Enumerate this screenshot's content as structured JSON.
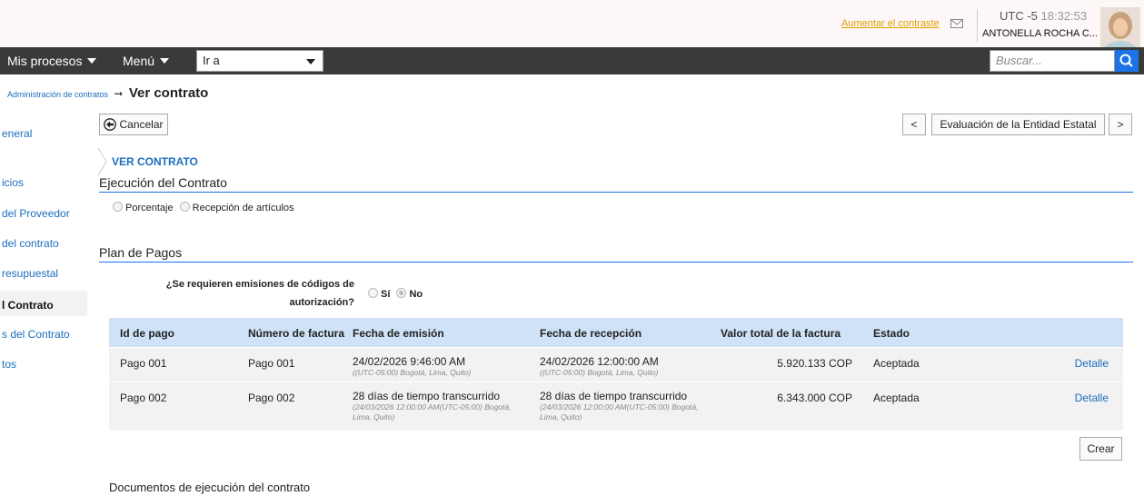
{
  "header": {
    "contrast_link": "Aumentar el contraste",
    "timezone_label": "UTC -5",
    "clock": "18:32:53",
    "username": "ANTONELLA ROCHA C..."
  },
  "nav": {
    "my_processes": "Mis procesos",
    "menu": "Menú",
    "goto_value": "Ir a",
    "search_placeholder": "Buscar..."
  },
  "breadcrumb": {
    "parent": "Administración de contratos",
    "arrow": "➞",
    "current": "Ver contrato"
  },
  "sidebar": {
    "items": [
      "eneral",
      "icios",
      "del Proveedor",
      "del contrato",
      "resupuestal",
      "l Contrato",
      "s del Contrato",
      "tos"
    ]
  },
  "actions": {
    "cancel": "Cancelar",
    "prev": "<",
    "next": ">",
    "evaluation": "Evaluación de la Entidad Estatal"
  },
  "section": {
    "link": "VER CONTRATO",
    "execution_title": "Ejecución del Contrato",
    "execution_options": [
      "Porcentaje",
      "Recepción de artículos"
    ],
    "plan_title": "Plan de Pagos",
    "auth_question_line1": "¿Se requieren emisiones de códigos de",
    "auth_question_line2": "autorización?",
    "auth_yes": "Sí",
    "auth_no": "No",
    "auth_selected": "No"
  },
  "table": {
    "headers": [
      "Id de pago",
      "Número de factura",
      "Fecha de emisión",
      "Fecha de recepción",
      "Valor total de la factura",
      "Estado"
    ],
    "rows": [
      {
        "id": "Pago 001",
        "invoice": "Pago 001",
        "issue_main": "24/02/2026 9:46:00 AM",
        "issue_sub": "((UTC-05:00) Bogotá, Lima, Quito)",
        "receipt_main": "24/02/2026 12:00:00 AM",
        "receipt_sub": "((UTC-05:00) Bogotá, Lima, Quito)",
        "total": "5.920.133 COP",
        "status": "Aceptada",
        "detail": "Detalle"
      },
      {
        "id": "Pago 002",
        "invoice": "Pago 002",
        "issue_main": "28 días de tiempo transcurrido",
        "issue_sub": "(24/03/2026 12:00:00 AM(UTC-05:00) Bogotá, Lima, Quito)",
        "receipt_main": "28 días de tiempo transcurrido",
        "receipt_sub": "(24/03/2026 12:00:00 AM(UTC-05:00) Bogotá, Lima, Quito)",
        "total": "6.343.000 COP",
        "status": "Aceptada",
        "detail": "Detalle"
      }
    ],
    "create_button": "Crear"
  },
  "documents_title": "Documentos de ejecución del contrato",
  "colors": {
    "nav_bg": "#3a3a3a",
    "link": "#1a6ebd",
    "accent": "#1a73e8",
    "table_header": "#cfe2f7",
    "contrast_link": "#e0a000"
  }
}
